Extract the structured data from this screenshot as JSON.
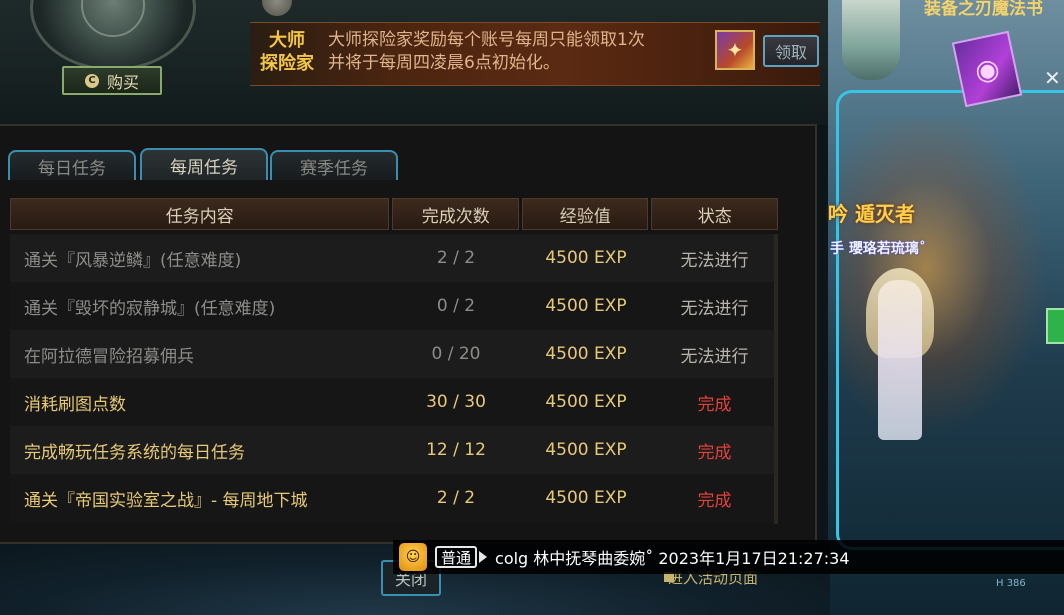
{
  "header": {
    "buy_label": "购买",
    "notice_title_line1": "大师",
    "notice_title_line2": "探险家",
    "notice_text_line1": "大师探险家奖励每个账号每周只能领取1次",
    "notice_text_line2": "并将于每周四凌晨6点初始化。",
    "claim_label": "领取"
  },
  "tabs": [
    {
      "label": "每日任务",
      "active": false
    },
    {
      "label": "每周任务",
      "active": true
    },
    {
      "label": "赛季任务",
      "active": false
    }
  ],
  "table": {
    "headers": [
      "任务内容",
      "完成次数",
      "经验值",
      "状态"
    ],
    "rows": [
      {
        "task": "通关『风暴逆鳞』(任意难度)",
        "count": "2 / 2",
        "exp": "4500 EXP",
        "status": "无法进行"
      },
      {
        "task": "通关『毁坏的寂静城』(任意难度)",
        "count": "0 / 2",
        "exp": "4500 EXP",
        "status": "无法进行"
      },
      {
        "task": "在阿拉德冒险招募佣兵",
        "count": "0 / 20",
        "exp": "4500 EXP",
        "status": "无法进行"
      },
      {
        "task": "消耗刷图点数",
        "count": "30 / 30",
        "exp": "4500 EXP",
        "status": "完成"
      },
      {
        "task": "完成畅玩任务系统的每日任务",
        "count": "12 / 12",
        "exp": "4500 EXP",
        "status": "完成"
      },
      {
        "task": "通关『帝国实验室之战』- 每周地下城",
        "count": "2 / 2",
        "exp": "4500 EXP",
        "status": "完成"
      }
    ]
  },
  "footer": {
    "close_label": "关闭",
    "link_label": "进入活动页面"
  },
  "chat": {
    "channel": "普通",
    "message": "colg 林中抚琴曲委婉˚ 2023年1月17日21:27:34"
  },
  "side": {
    "title": "装备之刃魔法书",
    "banner": "吟 遁灭者",
    "player_name": "手 瓔珞若琉璃˚",
    "stat": "H 386"
  },
  "colors": {
    "accent_blue": "#3a8fb0",
    "gold_text": "#e7c977",
    "complete_red": "#e0423a",
    "locked_gray": "#8c8c88"
  }
}
